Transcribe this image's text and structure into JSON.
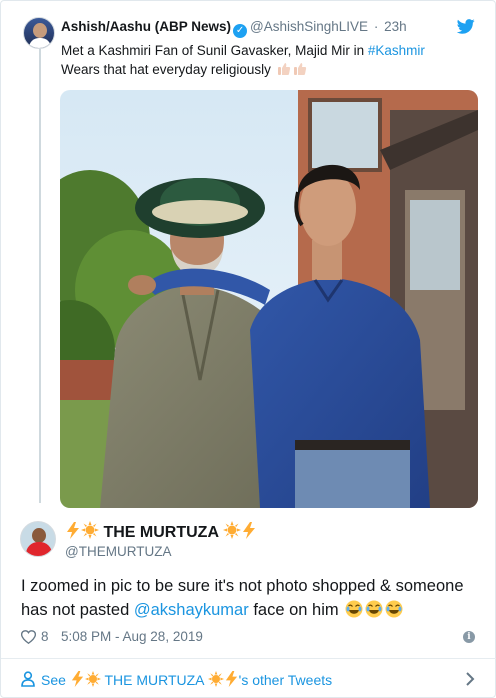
{
  "quoted_tweet": {
    "author_name": "Ashish/Aashu (ABP News)",
    "author_handle": "@AshishSinghLIVE",
    "time": "23h",
    "text_line1": "Met a Kashmiri Fan of Sunil Gavasker, Majid Mir in",
    "hashtag": "#Kashmir",
    "text_line2": "Wears that hat everyday religiously"
  },
  "reply": {
    "author_name": "THE MURTUZA",
    "author_handle": "@THEMURTUZA",
    "text_before": "I zoomed in pic to be sure it's not photo shopped & someone has not pasted",
    "mention": "@akshaykumar",
    "text_after": "face on him",
    "likes": "8",
    "timestamp": "5:08 PM - Aug 28, 2019"
  },
  "footer": {
    "see_label": "See",
    "name": "THE MURTUZA",
    "suffix": "'s other Tweets"
  },
  "colors": {
    "link": "#1b95e0",
    "verified": "#1da1f2",
    "muted": "#657786",
    "border": "#e1e8ed"
  },
  "icons": [
    "twitter-bird-icon",
    "verified-badge-icon",
    "heart-icon",
    "info-icon",
    "person-icon",
    "chevron-right-icon",
    "lightning-emoji",
    "sun-emoji",
    "thumbs-up-emoji",
    "laughing-emoji"
  ]
}
